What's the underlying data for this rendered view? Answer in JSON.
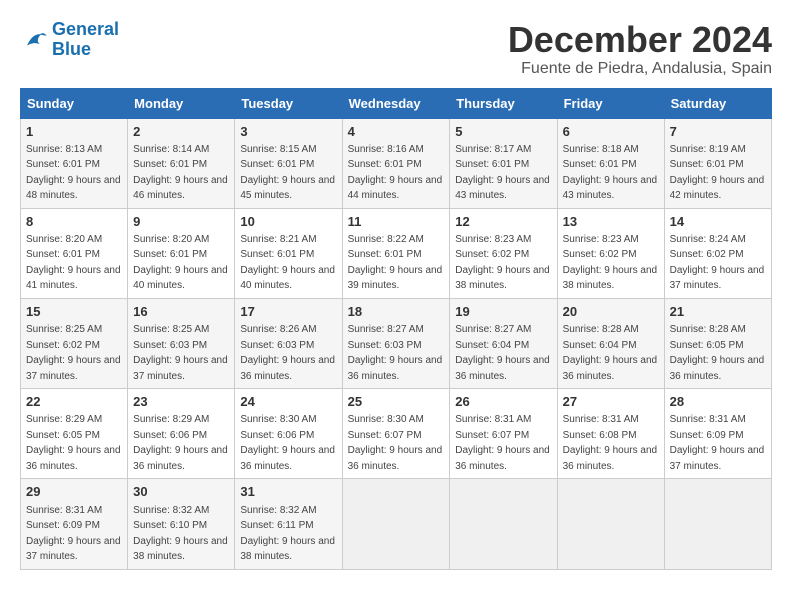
{
  "logo": {
    "line1": "General",
    "line2": "Blue"
  },
  "title": "December 2024",
  "subtitle": "Fuente de Piedra, Andalusia, Spain",
  "header": {
    "days": [
      "Sunday",
      "Monday",
      "Tuesday",
      "Wednesday",
      "Thursday",
      "Friday",
      "Saturday"
    ]
  },
  "weeks": [
    [
      {
        "day": "1",
        "sunrise": "8:13 AM",
        "sunset": "6:01 PM",
        "daylight": "9 hours and 48 minutes."
      },
      {
        "day": "2",
        "sunrise": "8:14 AM",
        "sunset": "6:01 PM",
        "daylight": "9 hours and 46 minutes."
      },
      {
        "day": "3",
        "sunrise": "8:15 AM",
        "sunset": "6:01 PM",
        "daylight": "9 hours and 45 minutes."
      },
      {
        "day": "4",
        "sunrise": "8:16 AM",
        "sunset": "6:01 PM",
        "daylight": "9 hours and 44 minutes."
      },
      {
        "day": "5",
        "sunrise": "8:17 AM",
        "sunset": "6:01 PM",
        "daylight": "9 hours and 43 minutes."
      },
      {
        "day": "6",
        "sunrise": "8:18 AM",
        "sunset": "6:01 PM",
        "daylight": "9 hours and 43 minutes."
      },
      {
        "day": "7",
        "sunrise": "8:19 AM",
        "sunset": "6:01 PM",
        "daylight": "9 hours and 42 minutes."
      }
    ],
    [
      {
        "day": "8",
        "sunrise": "8:20 AM",
        "sunset": "6:01 PM",
        "daylight": "9 hours and 41 minutes."
      },
      {
        "day": "9",
        "sunrise": "8:20 AM",
        "sunset": "6:01 PM",
        "daylight": "9 hours and 40 minutes."
      },
      {
        "day": "10",
        "sunrise": "8:21 AM",
        "sunset": "6:01 PM",
        "daylight": "9 hours and 40 minutes."
      },
      {
        "day": "11",
        "sunrise": "8:22 AM",
        "sunset": "6:01 PM",
        "daylight": "9 hours and 39 minutes."
      },
      {
        "day": "12",
        "sunrise": "8:23 AM",
        "sunset": "6:02 PM",
        "daylight": "9 hours and 38 minutes."
      },
      {
        "day": "13",
        "sunrise": "8:23 AM",
        "sunset": "6:02 PM",
        "daylight": "9 hours and 38 minutes."
      },
      {
        "day": "14",
        "sunrise": "8:24 AM",
        "sunset": "6:02 PM",
        "daylight": "9 hours and 37 minutes."
      }
    ],
    [
      {
        "day": "15",
        "sunrise": "8:25 AM",
        "sunset": "6:02 PM",
        "daylight": "9 hours and 37 minutes."
      },
      {
        "day": "16",
        "sunrise": "8:25 AM",
        "sunset": "6:03 PM",
        "daylight": "9 hours and 37 minutes."
      },
      {
        "day": "17",
        "sunrise": "8:26 AM",
        "sunset": "6:03 PM",
        "daylight": "9 hours and 36 minutes."
      },
      {
        "day": "18",
        "sunrise": "8:27 AM",
        "sunset": "6:03 PM",
        "daylight": "9 hours and 36 minutes."
      },
      {
        "day": "19",
        "sunrise": "8:27 AM",
        "sunset": "6:04 PM",
        "daylight": "9 hours and 36 minutes."
      },
      {
        "day": "20",
        "sunrise": "8:28 AM",
        "sunset": "6:04 PM",
        "daylight": "9 hours and 36 minutes."
      },
      {
        "day": "21",
        "sunrise": "8:28 AM",
        "sunset": "6:05 PM",
        "daylight": "9 hours and 36 minutes."
      }
    ],
    [
      {
        "day": "22",
        "sunrise": "8:29 AM",
        "sunset": "6:05 PM",
        "daylight": "9 hours and 36 minutes."
      },
      {
        "day": "23",
        "sunrise": "8:29 AM",
        "sunset": "6:06 PM",
        "daylight": "9 hours and 36 minutes."
      },
      {
        "day": "24",
        "sunrise": "8:30 AM",
        "sunset": "6:06 PM",
        "daylight": "9 hours and 36 minutes."
      },
      {
        "day": "25",
        "sunrise": "8:30 AM",
        "sunset": "6:07 PM",
        "daylight": "9 hours and 36 minutes."
      },
      {
        "day": "26",
        "sunrise": "8:31 AM",
        "sunset": "6:07 PM",
        "daylight": "9 hours and 36 minutes."
      },
      {
        "day": "27",
        "sunrise": "8:31 AM",
        "sunset": "6:08 PM",
        "daylight": "9 hours and 36 minutes."
      },
      {
        "day": "28",
        "sunrise": "8:31 AM",
        "sunset": "6:09 PM",
        "daylight": "9 hours and 37 minutes."
      }
    ],
    [
      {
        "day": "29",
        "sunrise": "8:31 AM",
        "sunset": "6:09 PM",
        "daylight": "9 hours and 37 minutes."
      },
      {
        "day": "30",
        "sunrise": "8:32 AM",
        "sunset": "6:10 PM",
        "daylight": "9 hours and 38 minutes."
      },
      {
        "day": "31",
        "sunrise": "8:32 AM",
        "sunset": "6:11 PM",
        "daylight": "9 hours and 38 minutes."
      },
      null,
      null,
      null,
      null
    ]
  ]
}
